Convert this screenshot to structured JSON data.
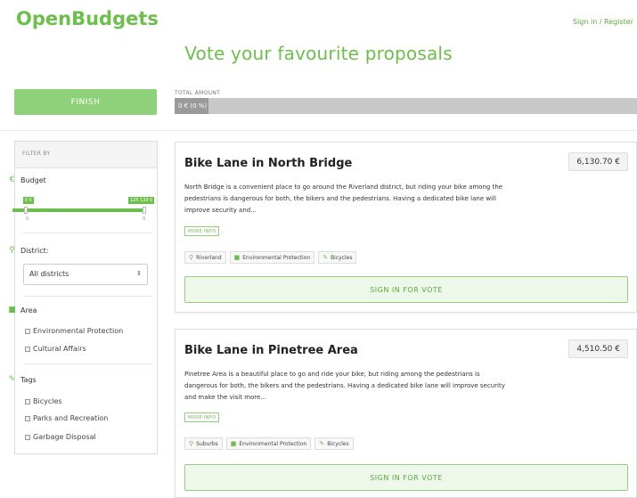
{
  "header": {
    "logo": "OpenBudgets",
    "signin": "Sign in / Register",
    "title": "Vote your favourite proposals"
  },
  "actions": {
    "finish_label": "FINISH"
  },
  "total": {
    "label": "TOTAL AMOUNT",
    "value": "0 € (0 %)"
  },
  "filters": {
    "heading": "FILTER BY",
    "budget": {
      "label": "Budget",
      "min_badge": "0 €",
      "max_badge": "125 120 €",
      "min_tick": "0",
      "max_tick": "0",
      "range_fraction": [
        0.0,
        1.0
      ]
    },
    "district": {
      "label": "District:",
      "selected": "All districts"
    },
    "area": {
      "label": "Area",
      "items": [
        "Environmental Protection",
        "Cultural Affairs"
      ]
    },
    "tags": {
      "label": "Tags",
      "items": [
        "Bicycles",
        "Parks and Recreation",
        "Garbage Disposal"
      ]
    }
  },
  "proposals": [
    {
      "title": "Bike Lane in North Bridge",
      "price": "6,130.70 €",
      "description": "North Bridge is a convenient place to go around the Riverland district, but riding your bike among the pedestrians is dangerous for both, the bikers and the pedestrians. Having a dedicated bike lane will improve security and...",
      "more_info": "MORE INFO",
      "tags": [
        {
          "icon": "location-icon",
          "label": "Riverland"
        },
        {
          "icon": "folder-icon",
          "label": "Environmental Protection"
        },
        {
          "icon": "tag-icon",
          "label": "Bicycles"
        }
      ],
      "vote_label": "SIGN IN FOR VOTE"
    },
    {
      "title": "Bike Lane in Pinetree Area",
      "price": "4,510.50 €",
      "description": "Pinetree Area is a beautiful place to go and ride your bike, but riding among the pedestrians is dangerous for both, the bikers and the pedestrians. Having a dedicated bike lane will improve security and make the visit more...",
      "more_info": "MORE INFO",
      "tags": [
        {
          "icon": "location-icon",
          "label": "Suburbs"
        },
        {
          "icon": "folder-icon",
          "label": "Environmental Protection"
        },
        {
          "icon": "tag-icon",
          "label": "Bicycles"
        }
      ],
      "vote_label": "SIGN IN FOR VOTE"
    }
  ],
  "colors": {
    "accent": "#6cbf4a",
    "accent_light": "#8fd17a",
    "bar_grey": "#c8c8c8"
  }
}
